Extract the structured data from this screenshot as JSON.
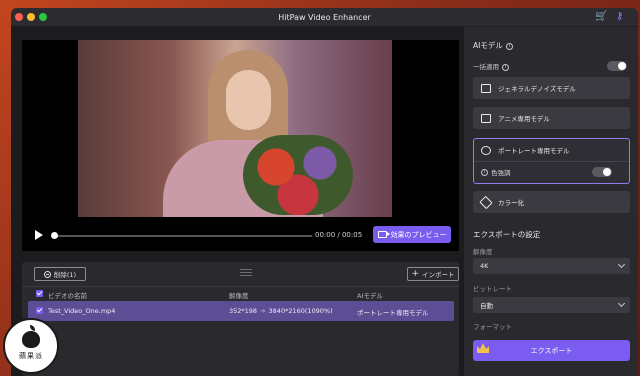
{
  "app": {
    "title": "HitPaw Video Enhancer",
    "accent": "#7a5cf0",
    "icons": [
      "cart-icon",
      "key-icon"
    ]
  },
  "player": {
    "current_time": "00:00",
    "separator": " / ",
    "duration": "00:05",
    "time_text": "00:00 / 00:05",
    "preview_label": "効果のプレビュー",
    "progress": 0.0
  },
  "file_list": {
    "delete_label": "削除(1)",
    "import_label": "インポート",
    "columns": {
      "name": "ビデオの名前",
      "resolution": "解像度",
      "model": "AIモデル"
    },
    "rows": [
      {
        "checked": true,
        "name": "Test_Video_One.mp4",
        "resolution_from": "352*198",
        "resolution_to": "3840*2160(1090%)",
        "model": "ポートレート専用モデル"
      }
    ]
  },
  "ai_panel": {
    "title": "AIモデル",
    "batch_label": "一括適用",
    "batch_enabled": false,
    "models": [
      {
        "label": "ジェネラルデノイズモデル",
        "icon": "film-icon"
      },
      {
        "label": "アニメ専用モデル",
        "icon": "anime-icon"
      },
      {
        "label": "ポートレート専用モデル",
        "icon": "face-icon",
        "selected": true
      },
      {
        "label": "カラー化",
        "icon": "colorize-icon"
      }
    ],
    "color_enhance_label": "色強調",
    "color_enhance_enabled": false
  },
  "export": {
    "title": "エクスポートの設定",
    "resolution_label": "解像度",
    "resolution_value": "4K",
    "bitrate_label": "ビットレート",
    "bitrate_value": "自動",
    "format_label": "フォーマット",
    "export_label": "エクスポート"
  },
  "watermark": {
    "text": "蘋果派"
  }
}
